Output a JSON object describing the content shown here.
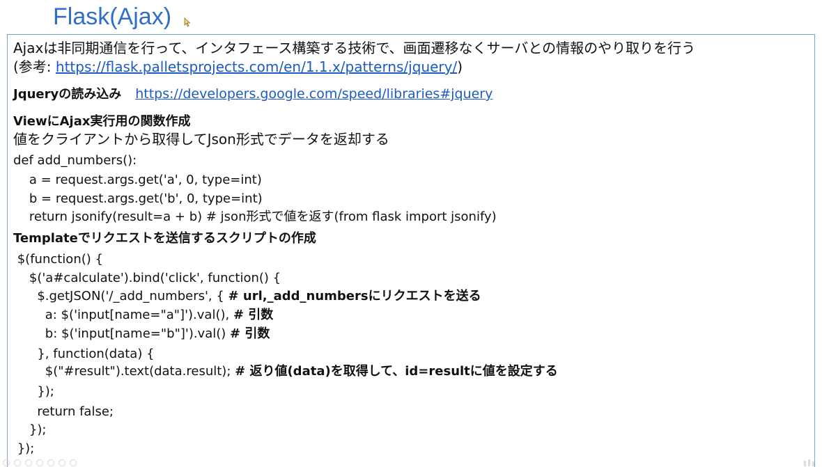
{
  "title": "Flask(Ajax)",
  "intro": {
    "line1": "Ajaxは非同期通信を行って、インタフェース構築する技術で、画面遷移なくサーバとの情報のやり取りを行う",
    "ref_prefix": "(参考: ",
    "ref_link": "https://flask.palletsprojects.com/en/1.1.x/patterns/jquery/",
    "ref_suffix": ")"
  },
  "jquery": {
    "heading": "Jqueryの読み込み",
    "link": "https://developers.google.com/speed/libraries#jquery"
  },
  "view": {
    "heading": "ViewにAjax実行用の関数作成",
    "desc": "値をクライアントから取得してJson形式でデータを返却する",
    "code": [
      "def add_numbers():",
      "    a = request.args.get('a', 0, type=int)",
      "    b = request.args.get('b', 0, type=int)",
      "    return jsonify(result=a + b) # json形式で値を返す(from flask import jsonify)"
    ]
  },
  "template": {
    "heading": "Templateでリクエストを送信するスクリプトの作成",
    "code": [
      {
        "text": " $(function() {",
        "comment": ""
      },
      {
        "text": "    $('a#calculate').bind('click', function() {",
        "comment": ""
      },
      {
        "text": "      $.getJSON('/_add_numbers', { ",
        "comment": "# url,_add_numbersにリクエストを送る"
      },
      {
        "text": "        a: $('input[name=\"a\"]').val(), ",
        "comment": "# 引数"
      },
      {
        "text": "        b: $('input[name=\"b\"]').val() ",
        "comment": "# 引数"
      },
      {
        "text": "      }, function(data) {",
        "comment": ""
      },
      {
        "text": "        $(\"#result\").text(data.result); ",
        "comment": "# 返り値(data)を取得して、id=resultに値を設定する"
      },
      {
        "text": "      });",
        "comment": ""
      },
      {
        "text": "      return false;",
        "comment": ""
      },
      {
        "text": "    });",
        "comment": ""
      },
      {
        "text": " });",
        "comment": ""
      }
    ]
  },
  "colors": {
    "title": "#2f6fc6",
    "link": "#1a5bc4",
    "border": "#7f9ed6"
  }
}
